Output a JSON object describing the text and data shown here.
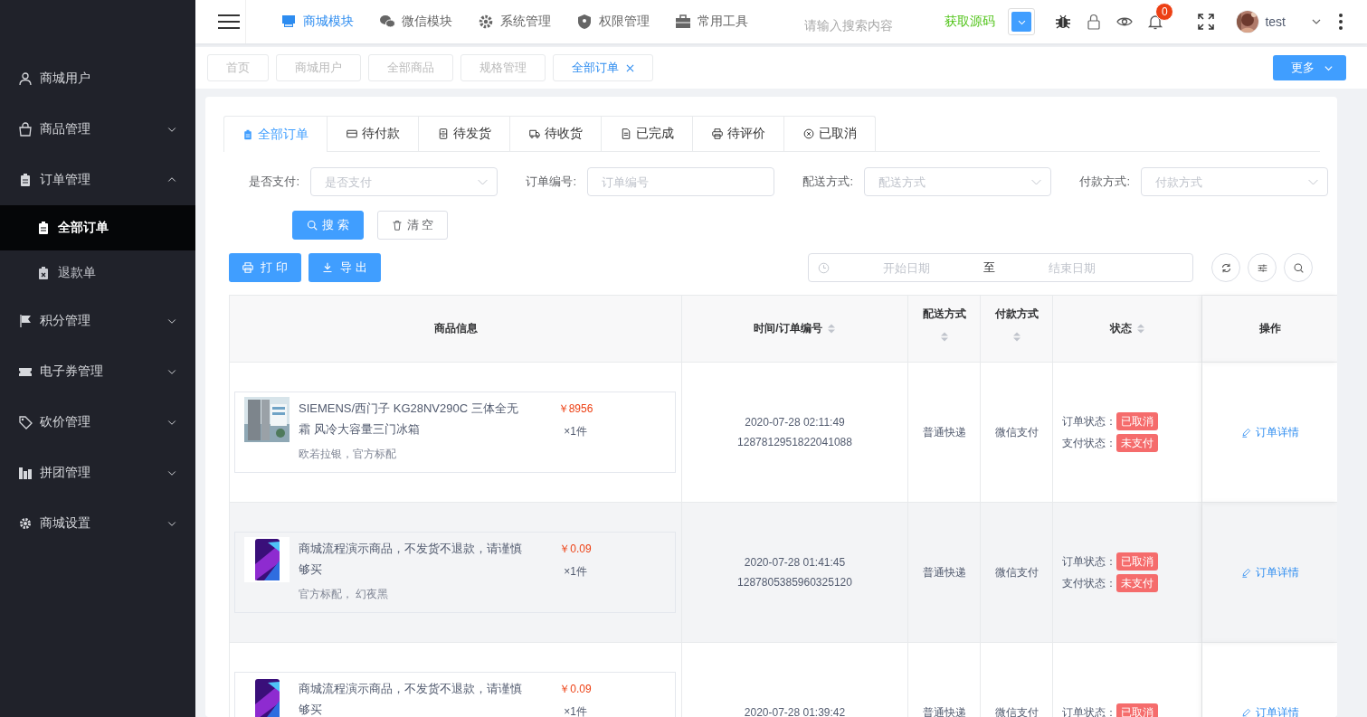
{
  "sidebar": {
    "items": [
      {
        "label": "商城用户",
        "kind": "link"
      },
      {
        "label": "商品管理",
        "kind": "group",
        "expanded": false
      },
      {
        "label": "订单管理",
        "kind": "group",
        "expanded": true,
        "children": [
          {
            "label": "全部订单",
            "selected": true
          },
          {
            "label": "退款单",
            "selected": false
          }
        ]
      },
      {
        "label": "积分管理",
        "kind": "group",
        "expanded": false
      },
      {
        "label": "电子券管理",
        "kind": "group",
        "expanded": false
      },
      {
        "label": "砍价管理",
        "kind": "group",
        "expanded": false
      },
      {
        "label": "拼团管理",
        "kind": "group",
        "expanded": false
      },
      {
        "label": "商城设置",
        "kind": "group",
        "expanded": false
      }
    ]
  },
  "header": {
    "modules": [
      {
        "label": "商城模块",
        "selected": true
      },
      {
        "label": "微信模块",
        "selected": false
      },
      {
        "label": "系统管理",
        "selected": false
      },
      {
        "label": "权限管理",
        "selected": false
      },
      {
        "label": "常用工具",
        "selected": false
      }
    ],
    "search": {
      "placeholder": "请输入搜索内容"
    },
    "source_link": "获取源码",
    "notification_count": "0",
    "user": "test"
  },
  "page_tabs": {
    "tabs": [
      {
        "label": "首页",
        "selected": false,
        "closable": false
      },
      {
        "label": "商城用户",
        "selected": false,
        "closable": false
      },
      {
        "label": "全部商品",
        "selected": false,
        "closable": false
      },
      {
        "label": "规格管理",
        "selected": false,
        "closable": false
      },
      {
        "label": "全部订单",
        "selected": true,
        "closable": true
      }
    ],
    "more_button": "更多"
  },
  "order_tabs": [
    {
      "label": "全部订单",
      "selected": true
    },
    {
      "label": "待付款",
      "selected": false
    },
    {
      "label": "待发货",
      "selected": false
    },
    {
      "label": "待收货",
      "selected": false
    },
    {
      "label": "已完成",
      "selected": false
    },
    {
      "label": "待评价",
      "selected": false
    },
    {
      "label": "已取消",
      "selected": false
    }
  ],
  "filters": [
    {
      "label": "是否支付:",
      "placeholder": "是否支付",
      "kind": "select"
    },
    {
      "label": "订单编号:",
      "placeholder": "订单编号",
      "kind": "input"
    },
    {
      "label": "配送方式:",
      "placeholder": "配送方式",
      "kind": "select"
    },
    {
      "label": "付款方式:",
      "placeholder": "付款方式",
      "kind": "select"
    }
  ],
  "filter_buttons": [
    {
      "label": "搜 索",
      "kind": "primary"
    },
    {
      "label": "清 空",
      "kind": "plain"
    }
  ],
  "toolbar": {
    "buttons": [
      "打 印",
      "导 出"
    ],
    "date_range": {
      "start_placeholder": "开始日期",
      "separator": "至",
      "end_placeholder": "结束日期"
    }
  },
  "table": {
    "columns": [
      {
        "label": "商品信息",
        "sortable": false
      },
      {
        "label": "时间/订单编号",
        "sortable": true
      },
      {
        "label": "配送方式",
        "sortable": true
      },
      {
        "label": "付款方式",
        "sortable": true
      },
      {
        "label": "状态",
        "sortable": true
      },
      {
        "label": "操作",
        "sortable": false
      }
    ],
    "rows": [
      {
        "highlighted": false,
        "product": {
          "name": "SIEMENS/西门子 KG28NV290C 三体全无霜 风冷大容量三门冰箱",
          "spec": "欧若拉银，官方标配",
          "price": "￥8956",
          "quantity": "×1件"
        },
        "time": "2020-07-28 02:11:49",
        "order_no": "1287812951822041088",
        "delivery": "普通快递",
        "payment": "微信支付",
        "order_status_label": "订单状态：",
        "order_status": "已取消",
        "pay_status_label": "支付状态：",
        "pay_status": "未支付",
        "action": "订单详情"
      },
      {
        "highlighted": true,
        "product": {
          "name": "商城流程演示商品，不发货不退款，请谨慎够买",
          "spec": "官方标配， 幻夜黑",
          "price": "￥0.09",
          "quantity": "×1件"
        },
        "time": "2020-07-28 01:41:45",
        "order_no": "1287805385960325120",
        "delivery": "普通快递",
        "payment": "微信支付",
        "order_status_label": "订单状态：",
        "order_status": "已取消",
        "pay_status_label": "支付状态：",
        "pay_status": "未支付",
        "action": "订单详情"
      },
      {
        "highlighted": false,
        "product": {
          "name": "商城流程演示商品，不发货不退款，请谨慎够买",
          "price": "￥0.09",
          "quantity": "×1件"
        },
        "time": "2020-07-28 01:39:42",
        "delivery": "普通快递",
        "payment": "微信支付",
        "order_status_label": "订单状态：",
        "order_status": "已取消",
        "action": "订单详情"
      }
    ]
  }
}
